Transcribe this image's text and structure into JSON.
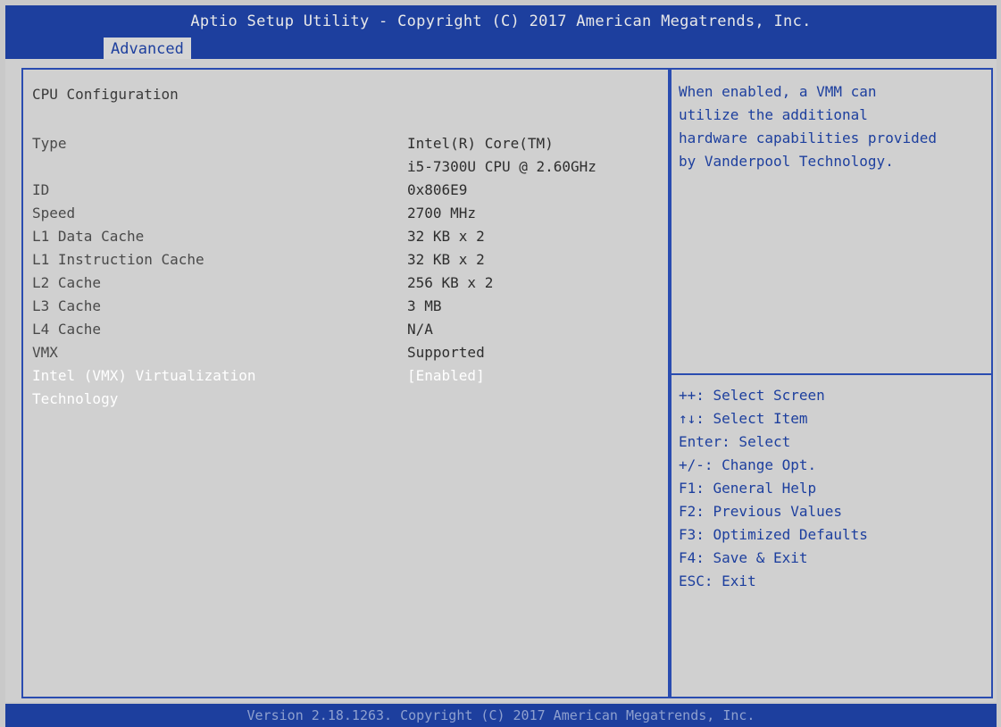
{
  "header": {
    "title": "Aptio Setup Utility - Copyright (C) 2017 American Megatrends, Inc.",
    "active_tab": "Advanced"
  },
  "main": {
    "section_title": "CPU Configuration",
    "rows": [
      {
        "label": "Type",
        "value": "Intel(R) Core(TM)",
        "value2": "i5-7300U CPU @ 2.60GHz"
      },
      {
        "label": "ID",
        "value": "0x806E9"
      },
      {
        "label": "Speed",
        "value": "2700 MHz"
      },
      {
        "label": "L1 Data Cache",
        "value": "32 KB x 2"
      },
      {
        "label": "L1 Instruction Cache",
        "value": "32 KB x 2"
      },
      {
        "label": "L2 Cache",
        "value": "256 KB x 2"
      },
      {
        "label": "L3 Cache",
        "value": "3 MB"
      },
      {
        "label": "L4 Cache",
        "value": "N/A"
      },
      {
        "label": "VMX",
        "value": "Supported"
      },
      {
        "label": "Intel (VMX) Virtualization",
        "label2": "Technology",
        "value": "[Enabled]"
      }
    ]
  },
  "help": {
    "lines": [
      "When enabled, a VMM can",
      "utilize the additional",
      "hardware capabilities provided",
      "by Vanderpool Technology."
    ]
  },
  "keys": [
    "++: Select Screen",
    "↑↓: Select Item",
    "Enter: Select",
    "+/-: Change Opt.",
    "F1: General Help",
    "F2: Previous Values",
    "F3: Optimized Defaults",
    "F4: Save & Exit",
    "ESC: Exit"
  ],
  "footer": {
    "text": "Version 2.18.1263. Copyright (C) 2017 American Megatrends, Inc."
  }
}
